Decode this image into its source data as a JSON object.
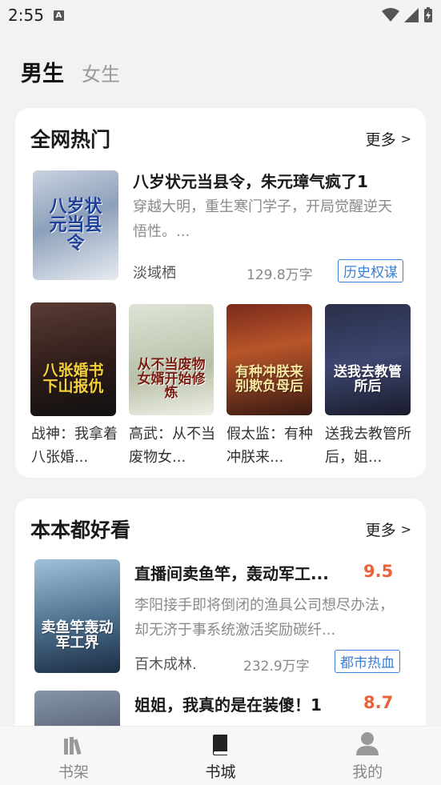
{
  "status_bar": {
    "time": "2:55",
    "notif_icon": "A"
  },
  "gender_tabs": {
    "male": "男生",
    "female": "女生"
  },
  "section_hot": {
    "title": "全网热门",
    "more": "更多",
    "featured": {
      "title": "八岁状元当县令，朱元璋气疯了1",
      "desc": "穿越大明，重生寒门学子，开局觉醒逆天悟性。...",
      "author": "淡域栖",
      "word_count": "129.8万字",
      "tag": "历史权谋",
      "cover_text": "八岁状元当县令"
    },
    "grid": [
      {
        "title": "战神：我拿着八张婚...",
        "cover_text": "八张婚书下山报仇"
      },
      {
        "title": "高武：从不当废物女...",
        "cover_text": "从不当废物女婿开始修炼"
      },
      {
        "title": "假太监：有种冲朕来...",
        "cover_text": "有种冲朕来别欺负母后"
      },
      {
        "title": "送我去教管所后，姐...",
        "cover_text": "送我去教管所后"
      }
    ]
  },
  "section_good": {
    "title": "本本都好看",
    "more": "更多",
    "books": [
      {
        "title": "直播间卖鱼竿，轰动军工...",
        "score": "9.5",
        "desc": "李阳接手即将倒闭的渔具公司想尽办法，却无济于事系统激活奖励碳纤...",
        "author": "百木成林.",
        "word_count": "232.9万字",
        "tag": "都市热血",
        "cover_text": "卖鱼竿轰动军工界"
      },
      {
        "title": "姐姐，我真的是在装傻！1",
        "score": "8.7"
      }
    ]
  },
  "bottom_nav": [
    {
      "label": "书架",
      "icon": "books-icon"
    },
    {
      "label": "书城",
      "icon": "book-icon"
    },
    {
      "label": "我的",
      "icon": "user-icon"
    }
  ],
  "colors": {
    "accent_blue": "#3b7fd6",
    "score_orange": "#e8623a"
  }
}
